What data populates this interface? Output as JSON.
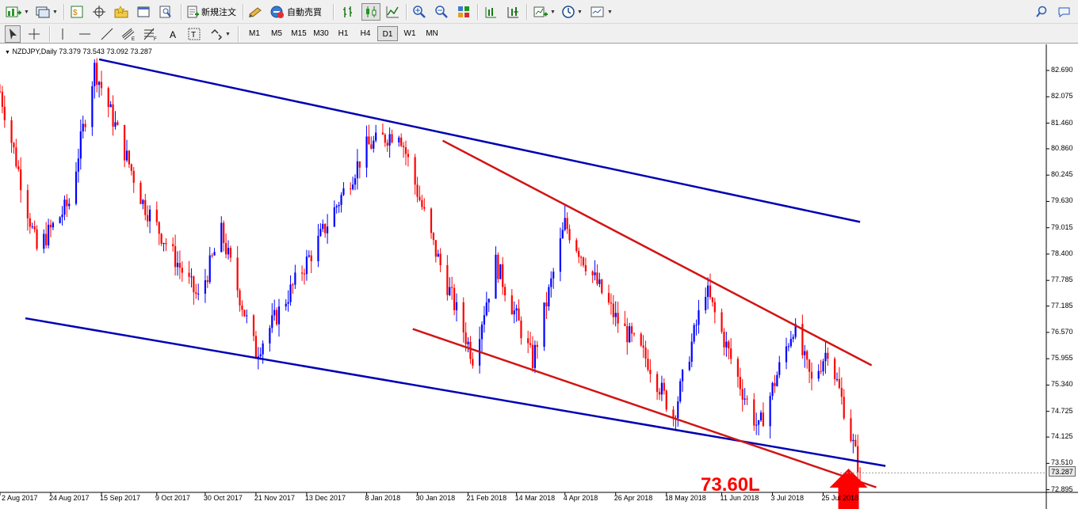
{
  "toolbar1": {
    "new_order_label": "新規注文",
    "auto_trade_label": "自動売買"
  },
  "toolbar2": {
    "timeframes": [
      "M1",
      "M5",
      "M15",
      "M30",
      "H1",
      "H4",
      "D1",
      "W1",
      "MN"
    ],
    "active_timeframe": "D1"
  },
  "chart_data": {
    "type": "candlestick",
    "symbol_label": "NZDJPY,Daily  73.379 73.543 73.092 73.287",
    "y_ticks": [
      "82.690",
      "82.075",
      "81.460",
      "80.860",
      "80.245",
      "79.630",
      "79.015",
      "78.400",
      "77.785",
      "77.185",
      "76.570",
      "75.955",
      "75.340",
      "74.725",
      "74.125",
      "73.510",
      "72.895"
    ],
    "y_tick_values": [
      82.69,
      82.075,
      81.46,
      80.86,
      80.245,
      79.63,
      79.015,
      78.4,
      77.785,
      77.185,
      76.57,
      75.955,
      75.34,
      74.725,
      74.125,
      73.51,
      72.895
    ],
    "x_ticks": [
      "2 Aug 2017",
      "24 Aug 2017",
      "15 Sep 2017",
      "9 Oct 2017",
      "30 Oct 2017",
      "21 Nov 2017",
      "13 Dec 2017",
      "8 Jan 2018",
      "30 Jan 2018",
      "21 Feb 2018",
      "14 Mar 2018",
      "4 Apr 2018",
      "26 Apr 2018",
      "18 May 2018",
      "11 Jun 2018",
      "3 Jul 2018",
      "25 Jul 2018"
    ],
    "current_price": "73.287",
    "annotation": "73.60L",
    "bull_color": "#0000ff",
    "bear_color": "#ff0000",
    "anchors": [
      {
        "date": "2 Aug 2017",
        "price": 82.2
      },
      {
        "date": "18 Aug 2017",
        "price": 78.5
      },
      {
        "date": "1 Sep 2017",
        "price": 79.6
      },
      {
        "date": "12 Sep 2017",
        "price": 82.75
      },
      {
        "date": "3 Oct 2017",
        "price": 79.6
      },
      {
        "date": "27 Oct 2017",
        "price": 77.35
      },
      {
        "date": "6 Nov 2017",
        "price": 78.9
      },
      {
        "date": "21 Nov 2017",
        "price": 76.1
      },
      {
        "date": "18 Dec 2017",
        "price": 78.7
      },
      {
        "date": "8 Jan 2018",
        "price": 80.9
      },
      {
        "date": "22 Jan 2018",
        "price": 81.3
      },
      {
        "date": "6 Feb 2018",
        "price": 78.6
      },
      {
        "date": "23 Feb 2018",
        "price": 76.0
      },
      {
        "date": "5 Mar 2018",
        "price": 78.2
      },
      {
        "date": "21 Mar 2018",
        "price": 75.9
      },
      {
        "date": "4 Apr 2018",
        "price": 79.1
      },
      {
        "date": "26 Apr 2018",
        "price": 76.9
      },
      {
        "date": "10 May 2018",
        "price": 75.9
      },
      {
        "date": "21 May 2018",
        "price": 74.6
      },
      {
        "date": "4 Jun 2018",
        "price": 77.6
      },
      {
        "date": "20 Jun 2018",
        "price": 75.2
      },
      {
        "date": "27 Jun 2018",
        "price": 74.3
      },
      {
        "date": "12 Jul 2018",
        "price": 76.7
      },
      {
        "date": "20 Jul 2018",
        "price": 75.4
      },
      {
        "date": "27 Jul 2018",
        "price": 76.2
      },
      {
        "date": "3 Aug 2018",
        "price": 74.8
      },
      {
        "date": "10 Aug 2018",
        "price": 73.29
      }
    ],
    "trendlines": [
      {
        "color": "#0000b4",
        "from": {
          "date": "14 Sep 2017",
          "price": 82.95
        },
        "to": {
          "date": "10 Aug 2018",
          "price": 79.15
        }
      },
      {
        "color": "#0000b4",
        "from": {
          "date": "13 Aug 2017",
          "price": 76.9
        },
        "to": {
          "date": "21 Aug 2018",
          "price": 73.45
        }
      },
      {
        "color": "#d21414",
        "from": {
          "date": "10 Feb 2018",
          "price": 81.05
        },
        "to": {
          "date": "15 Aug 2018",
          "price": 75.8
        }
      },
      {
        "color": "#d21414",
        "from": {
          "date": "28 Jan 2018",
          "price": 76.65
        },
        "to": {
          "date": "17 Aug 2018",
          "price": 72.95
        }
      }
    ],
    "arrow": {
      "color": "#ff0000",
      "date": "5 Aug 2018",
      "price_tip": 73.35
    }
  }
}
